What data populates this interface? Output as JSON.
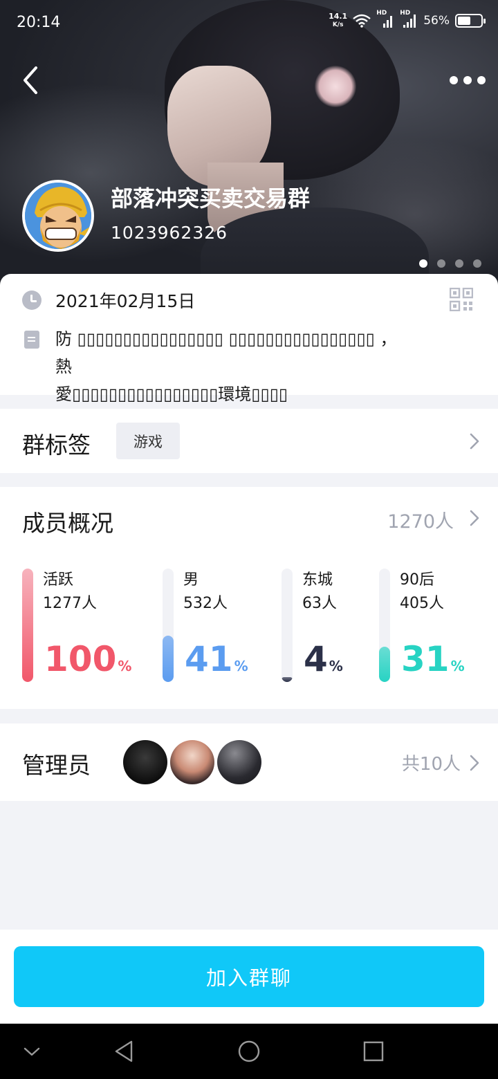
{
  "status_bar": {
    "time": "20:14",
    "net_speed_value": "14.1",
    "net_speed_unit": "K/s",
    "hd1": "HD",
    "hd2": "HD",
    "battery_percent_text": "56%",
    "battery_level": 0.56
  },
  "header": {
    "group_name": "部落冲突买卖交易群",
    "group_id": "1023962326",
    "carousel_pages": 4,
    "carousel_active": 0
  },
  "info": {
    "date": "2021年02月15日",
    "description_line1": "防 ▯▯▯▯▯▯▯▯▯▯▯▯▯▯▯▯ ▯▯▯▯▯▯▯▯▯▯▯▯▯▯▯▯ ， 熱",
    "description_line2": "愛▯▯▯▯▯▯▯▯▯▯▯▯▯▯▯▯環境▯▯▯▯"
  },
  "tags": {
    "title": "群标签",
    "items": [
      "游戏"
    ]
  },
  "members": {
    "title": "成员概况",
    "total": "1270人",
    "stats": [
      {
        "label": "活跃",
        "count": "1277人",
        "percent": "100",
        "value": 100,
        "color": "#f1576a",
        "track_color": "#f8e6ea"
      },
      {
        "label": "男",
        "count": "532人",
        "percent": "41",
        "value": 41,
        "color": "#5b9cf0",
        "track_color": "#f1f2f6"
      },
      {
        "label": "东城",
        "count": "63人",
        "percent": "4",
        "value": 4,
        "color": "#2b3048",
        "track_color": "#f1f2f6"
      },
      {
        "label": "90后",
        "count": "405人",
        "percent": "31",
        "value": 31,
        "color": "#27d3c3",
        "track_color": "#f1f2f6"
      }
    ],
    "percent_sign": "%"
  },
  "admins": {
    "title": "管理员",
    "total": "共10人"
  },
  "actions": {
    "join_label": "加入群聊"
  },
  "colors": {
    "accent": "#10c8f8",
    "muted_text": "#a0a4b0"
  }
}
